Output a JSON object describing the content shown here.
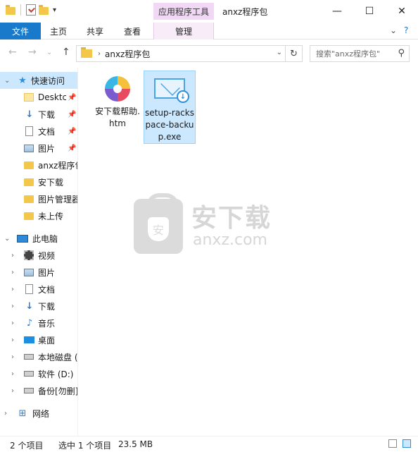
{
  "window": {
    "title": "anxz程序包",
    "contextual_tab": "应用程序工具",
    "minimize": "—",
    "maximize": "☐",
    "close": "✕"
  },
  "ribbon": {
    "file_tab": "文件",
    "tabs": [
      "主页",
      "共享",
      "查看"
    ],
    "manage_tab": "管理"
  },
  "address": {
    "crumb": "anxz程序包",
    "search_placeholder": "搜索\"anxz程序包\""
  },
  "navpane": {
    "quick_access": "快速访问",
    "quick_items": [
      {
        "label": "Desktc",
        "icon": "folder-light-icon",
        "pinned": true
      },
      {
        "label": "下载",
        "icon": "download-icon",
        "pinned": true
      },
      {
        "label": "文档",
        "icon": "document-icon",
        "pinned": true
      },
      {
        "label": "图片",
        "icon": "picture-icon",
        "pinned": true
      },
      {
        "label": "anxz程序包",
        "icon": "folder-icon",
        "pinned": false
      },
      {
        "label": "安下载",
        "icon": "folder-icon",
        "pinned": false
      },
      {
        "label": "图片管理器",
        "icon": "folder-icon",
        "pinned": false
      },
      {
        "label": "未上传",
        "icon": "folder-icon",
        "pinned": false
      }
    ],
    "this_pc": "此电脑",
    "pc_items": [
      {
        "label": "视频",
        "icon": "video-icon"
      },
      {
        "label": "图片",
        "icon": "picture-icon"
      },
      {
        "label": "文档",
        "icon": "document-icon"
      },
      {
        "label": "下载",
        "icon": "download-icon"
      },
      {
        "label": "音乐",
        "icon": "music-icon"
      },
      {
        "label": "桌面",
        "icon": "desktop-icon"
      },
      {
        "label": "本地磁盘 (",
        "icon": "local-disk-icon"
      },
      {
        "label": "软件 (D:)",
        "icon": "drive-icon"
      },
      {
        "label": "备份[勿删]",
        "icon": "drive-icon"
      }
    ],
    "network": "网络"
  },
  "files": [
    {
      "name": "安下载帮助.htm",
      "icon": "htm-file-icon",
      "selected": false
    },
    {
      "name": "setup-rackspace-backup.exe",
      "icon": "installer-icon",
      "selected": true
    }
  ],
  "watermark": {
    "cn": "安下载",
    "en": "anxz.com"
  },
  "status": {
    "item_count": "2 个项目",
    "selection": "选中 1 个项目",
    "size": "23.5 MB"
  }
}
